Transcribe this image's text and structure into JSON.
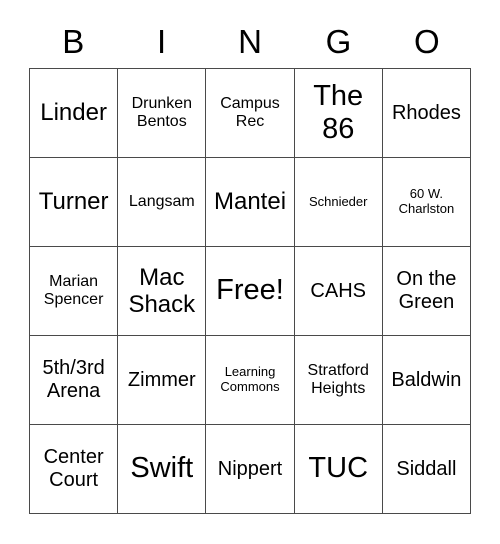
{
  "card": {
    "header_letters": [
      "B",
      "I",
      "N",
      "G",
      "O"
    ],
    "rows": [
      [
        {
          "text": "Linder",
          "size": "lg"
        },
        {
          "text": "Drunken\nBentos",
          "size": "sm"
        },
        {
          "text": "Campus\nRec",
          "size": "sm"
        },
        {
          "text": "The\n86",
          "size": "xl"
        },
        {
          "text": "Rhodes",
          "size": "md"
        }
      ],
      [
        {
          "text": "Turner",
          "size": "lg"
        },
        {
          "text": "Langsam",
          "size": "sm"
        },
        {
          "text": "Mantei",
          "size": "lg"
        },
        {
          "text": "Schnieder",
          "size": "xs"
        },
        {
          "text": "60 W.\nCharlston",
          "size": "xs"
        }
      ],
      [
        {
          "text": "Marian\nSpencer",
          "size": "sm"
        },
        {
          "text": "Mac\nShack",
          "size": "lg"
        },
        {
          "text": "Free!",
          "size": "xl"
        },
        {
          "text": "CAHS",
          "size": "md"
        },
        {
          "text": "On the\nGreen",
          "size": "md"
        }
      ],
      [
        {
          "text": "5th/3rd\nArena",
          "size": "md"
        },
        {
          "text": "Zimmer",
          "size": "md"
        },
        {
          "text": "Learning\nCommons",
          "size": "xs"
        },
        {
          "text": "Stratford\nHeights",
          "size": "sm"
        },
        {
          "text": "Baldwin",
          "size": "md"
        }
      ],
      [
        {
          "text": "Center\nCourt",
          "size": "md"
        },
        {
          "text": "Swift",
          "size": "xl"
        },
        {
          "text": "Nippert",
          "size": "md"
        },
        {
          "text": "TUC",
          "size": "xl"
        },
        {
          "text": "Siddall",
          "size": "md"
        }
      ]
    ],
    "colors": {
      "background": "#ffffff",
      "text": "#000000",
      "border": "#4a4a4a"
    }
  }
}
